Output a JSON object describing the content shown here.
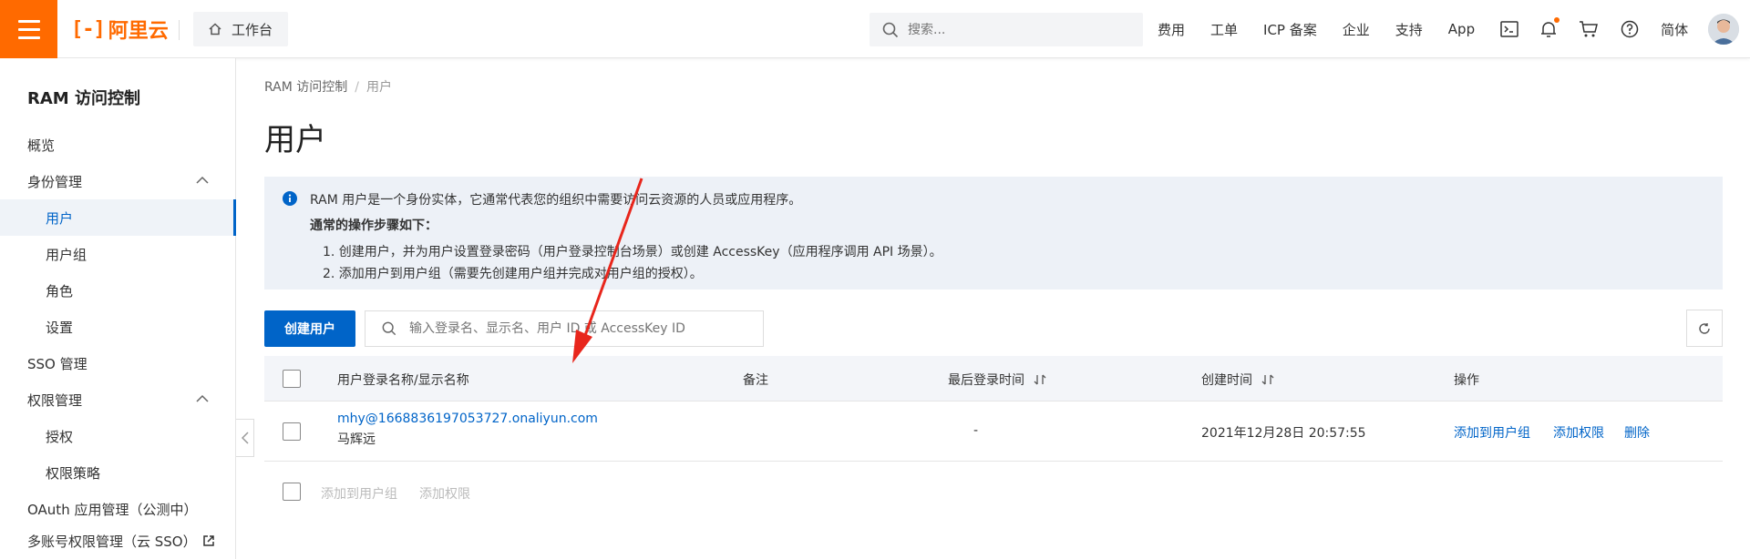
{
  "header": {
    "logo_text": "阿里云",
    "workbench_label": "工作台",
    "search_placeholder": "搜索...",
    "nav_links": [
      "费用",
      "工单",
      "ICP 备案",
      "企业",
      "支持",
      "App"
    ],
    "language": "简体",
    "accent_color": "#ff6a00",
    "icons": [
      "terminal-icon",
      "bell-icon",
      "cart-icon",
      "help-icon"
    ]
  },
  "sidebar": {
    "title": "RAM 访问控制",
    "items": [
      {
        "label": "概览"
      },
      {
        "label": "身份管理"
      },
      {
        "label": "用户"
      },
      {
        "label": "用户组"
      },
      {
        "label": "角色"
      },
      {
        "label": "设置"
      },
      {
        "label": "SSO 管理"
      },
      {
        "label": "权限管理"
      },
      {
        "label": "授权"
      },
      {
        "label": "权限策略"
      },
      {
        "label": "OAuth 应用管理（公测中）"
      },
      {
        "label": "多账号权限管理（云 SSO）"
      }
    ]
  },
  "main": {
    "breadcrumb": [
      "RAM 访问控制",
      "用户"
    ],
    "title": "用户",
    "info": {
      "line1": "RAM 用户是一个身份实体，它通常代表您的组织中需要访问云资源的人员或应用程序。",
      "heading": "通常的操作步骤如下：",
      "step1": "1. 创建用户，并为用户设置登录密码（用户登录控制台场景）或创建 AccessKey（应用程序调用 API 场景）。",
      "step2": "2. 添加用户到用户组（需要先创建用户组并完成对用户组的授权）。"
    },
    "create_button": "创建用户",
    "filter_placeholder": "输入登录名、显示名、用户 ID 或 AccessKey ID",
    "table": {
      "headers": [
        "用户登录名称/显示名称",
        "备注",
        "最后登录时间",
        "创建时间",
        "操作"
      ],
      "rows": [
        {
          "login": "mhy@1668836197053727.onaliyun.com",
          "display": "马辉远",
          "note": "",
          "last_login": "-",
          "created": "2021年12月28日 20:57:55",
          "actions": [
            "添加到用户组",
            "添加权限",
            "删除"
          ]
        }
      ]
    },
    "bulk_actions": [
      "添加到用户组",
      "添加权限"
    ],
    "primary_color": "#0064c8"
  }
}
